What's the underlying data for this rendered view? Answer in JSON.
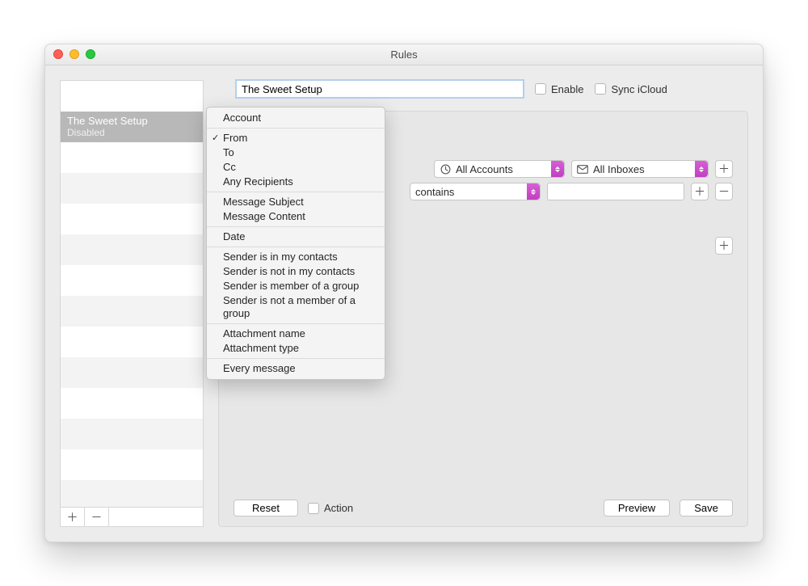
{
  "window": {
    "title": "Rules"
  },
  "sidebar": {
    "rules": [
      {
        "name": "The Sweet Setup",
        "status": "Disabled"
      }
    ]
  },
  "header": {
    "name_value": "The Sweet Setup",
    "enable_label": "Enable",
    "sync_label": "Sync iCloud"
  },
  "condition_menu": {
    "items": [
      {
        "label": "Account"
      },
      {
        "label": "From",
        "checked": true
      },
      {
        "label": "To"
      },
      {
        "label": "Cc"
      },
      {
        "label": "Any Recipients"
      },
      {
        "label": "Message Subject"
      },
      {
        "label": "Message Content"
      },
      {
        "label": "Date"
      },
      {
        "label": "Sender is in my contacts"
      },
      {
        "label": "Sender is not in my contacts"
      },
      {
        "label": "Sender is member of a group"
      },
      {
        "label": "Sender is not a member of a group"
      },
      {
        "label": "Attachment name"
      },
      {
        "label": "Attachment type"
      },
      {
        "label": "Every message"
      }
    ]
  },
  "conditions": {
    "row1": {
      "accounts_label": "All Accounts",
      "mailboxes_label": "All Inboxes"
    },
    "row2": {
      "operator_label": "contains"
    }
  },
  "footer": {
    "reset_label": "Reset",
    "action_label": "Action",
    "preview_label": "Preview",
    "save_label": "Save"
  },
  "glyphs": {
    "plus": "＋",
    "minus": "－"
  }
}
